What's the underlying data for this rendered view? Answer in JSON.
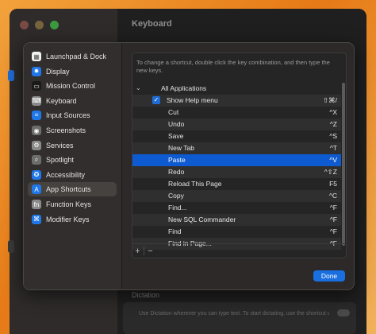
{
  "window": {
    "title": "Keyboard",
    "dictation": {
      "title": "Dictation",
      "description": "Use Dictation wherever you can type text. To start dictating, use the shortcut or select Start Dictation from the Edit menu."
    }
  },
  "sidebar": {
    "items": [
      {
        "label": "Launchpad & Dock",
        "icon": "launchpad-icon",
        "color": "#f3f3f3"
      },
      {
        "label": "Display",
        "icon": "display-icon",
        "color": "#1f77e8"
      },
      {
        "label": "Mission Control",
        "icon": "mission-control-icon",
        "color": "#1a1a1a"
      },
      {
        "label": "Keyboard",
        "icon": "keyboard-icon",
        "color": "#8a8a8a"
      },
      {
        "label": "Input Sources",
        "icon": "input-sources-icon",
        "color": "#1f77e8"
      },
      {
        "label": "Screenshots",
        "icon": "screenshots-icon",
        "color": "#6d6d6d"
      },
      {
        "label": "Services",
        "icon": "services-icon",
        "color": "#8a8a8a"
      },
      {
        "label": "Spotlight",
        "icon": "spotlight-icon",
        "color": "#6d6d6d"
      },
      {
        "label": "Accessibility",
        "icon": "accessibility-icon",
        "color": "#1f77e8"
      },
      {
        "label": "App Shortcuts",
        "icon": "app-shortcuts-icon",
        "color": "#1f77e8",
        "selected": true
      },
      {
        "label": "Function Keys",
        "icon": "function-keys-icon",
        "color": "#8a8a8a"
      },
      {
        "label": "Modifier Keys",
        "icon": "modifier-keys-icon",
        "color": "#1f77e8"
      }
    ]
  },
  "shortcuts": {
    "description": "To change a shortcut, double click the key combination, and then type the new keys.",
    "group_label": "All Applications",
    "show_help_menu": {
      "label": "Show Help menu",
      "keys": "⇧⌘/",
      "checked": true
    },
    "rows": [
      {
        "name": "Cut",
        "keys": "^X"
      },
      {
        "name": "Undo",
        "keys": "^Z"
      },
      {
        "name": "Save",
        "keys": "^S"
      },
      {
        "name": "New Tab",
        "keys": "^T"
      },
      {
        "name": "Paste",
        "keys": "^V",
        "selected": true
      },
      {
        "name": "Redo",
        "keys": "^⇧Z"
      },
      {
        "name": "Reload This Page",
        "keys": "F5"
      },
      {
        "name": "Copy",
        "keys": "^C"
      },
      {
        "name": "Find...",
        "keys": "^F"
      },
      {
        "name": "New SQL Commander",
        "keys": "^F"
      },
      {
        "name": "Find",
        "keys": "^F"
      },
      {
        "name": "Find in Page...",
        "keys": "^F"
      }
    ],
    "add_label": "+",
    "remove_label": "−"
  },
  "buttons": {
    "done_label": "Done"
  },
  "colors": {
    "accent": "#1a6fe0",
    "selection": "#0d5ad1"
  }
}
